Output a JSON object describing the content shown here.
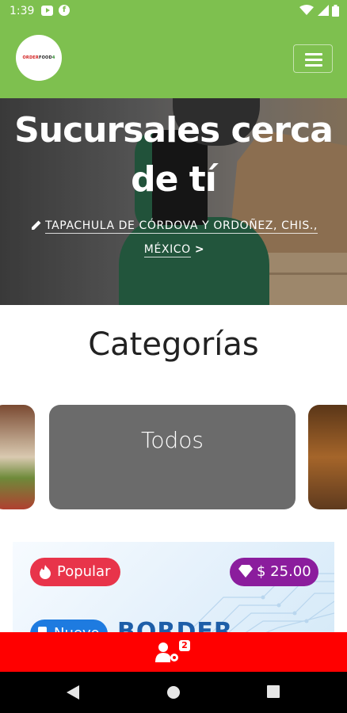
{
  "status_bar": {
    "time": "1:39",
    "f_icon_letter": "f"
  },
  "header": {
    "logo": {
      "part1": "ORDER",
      "part2": "FOOD",
      "part3": "4"
    },
    "menu_icon": "hamburger-icon"
  },
  "hero": {
    "title": "Sucursales cerca de tí",
    "location_line1": "TAPACHULA DE CÓRDOVA Y ORDOÑEZ, CHIS.,",
    "location_line2": "MÉXICO",
    "location_chevron": ">"
  },
  "categories": {
    "title": "Categorías",
    "selected": "Todos"
  },
  "product_banner": {
    "badge_popular": "Popular",
    "badge_price": "$ 25.00",
    "badge_new": "Nuevo",
    "brand_text": "BORDER"
  },
  "bottom_bar": {
    "badge_count": "2",
    "icon": "user-gear-icon"
  },
  "colors": {
    "header_green": "#7ec04f",
    "accent_red": "#ff0000",
    "popular_red": "#e8344a",
    "price_purple": "#8b1d9d",
    "category_gray": "#6b6b6b"
  }
}
